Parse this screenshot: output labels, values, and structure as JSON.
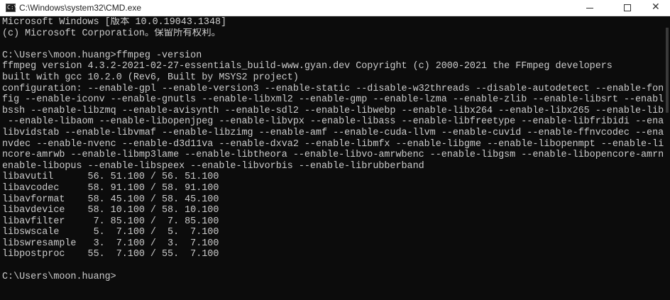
{
  "window": {
    "title": "C:\\Windows\\system32\\CMD.exe",
    "icon_glyph": "C:\\",
    "minimize_glyph": "",
    "close_glyph": "✕"
  },
  "console": {
    "lines": [
      "Microsoft Windows [版本 10.0.19043.1348]",
      "(c) Microsoft Corporation。保留所有权利。",
      "",
      "C:\\Users\\moon.huang>ffmpeg -version",
      "ffmpeg version 4.3.2-2021-02-27-essentials_build-www.gyan.dev Copyright (c) 2000-2021 the FFmpeg developers",
      "built with gcc 10.2.0 (Rev6, Built by MSYS2 project)",
      "configuration: --enable-gpl --enable-version3 --enable-static --disable-w32threads --disable-autodetect --enable-fontcon",
      "fig --enable-iconv --enable-gnutls --enable-libxml2 --enable-gmp --enable-lzma --enable-zlib --enable-libsrt --enable-li",
      "bssh --enable-libzmq --enable-avisynth --enable-sdl2 --enable-libwebp --enable-libx264 --enable-libx265 --enable-libxvid",
      " --enable-libaom --enable-libopenjpeg --enable-libvpx --enable-libass --enable-libfreetype --enable-libfribidi --enable-",
      "libvidstab --enable-libvmaf --enable-libzimg --enable-amf --enable-cuda-llvm --enable-cuvid --enable-ffnvcodec --enable-",
      "nvdec --enable-nvenc --enable-d3d11va --enable-dxva2 --enable-libmfx --enable-libgme --enable-libopenmpt --enable-libope",
      "ncore-amrwb --enable-libmp3lame --enable-libtheora --enable-libvo-amrwbenc --enable-libgsm --enable-libopencore-amrnb --",
      "enable-libopus --enable-libspeex --enable-libvorbis --enable-librubberband",
      "libavutil      56. 51.100 / 56. 51.100",
      "libavcodec     58. 91.100 / 58. 91.100",
      "libavformat    58. 45.100 / 58. 45.100",
      "libavdevice    58. 10.100 / 58. 10.100",
      "libavfilter     7. 85.100 /  7. 85.100",
      "libswscale      5.  7.100 /  5.  7.100",
      "libswresample   3.  7.100 /  3.  7.100",
      "libpostproc    55.  7.100 / 55.  7.100",
      "",
      "C:\\Users\\moon.huang>"
    ]
  }
}
